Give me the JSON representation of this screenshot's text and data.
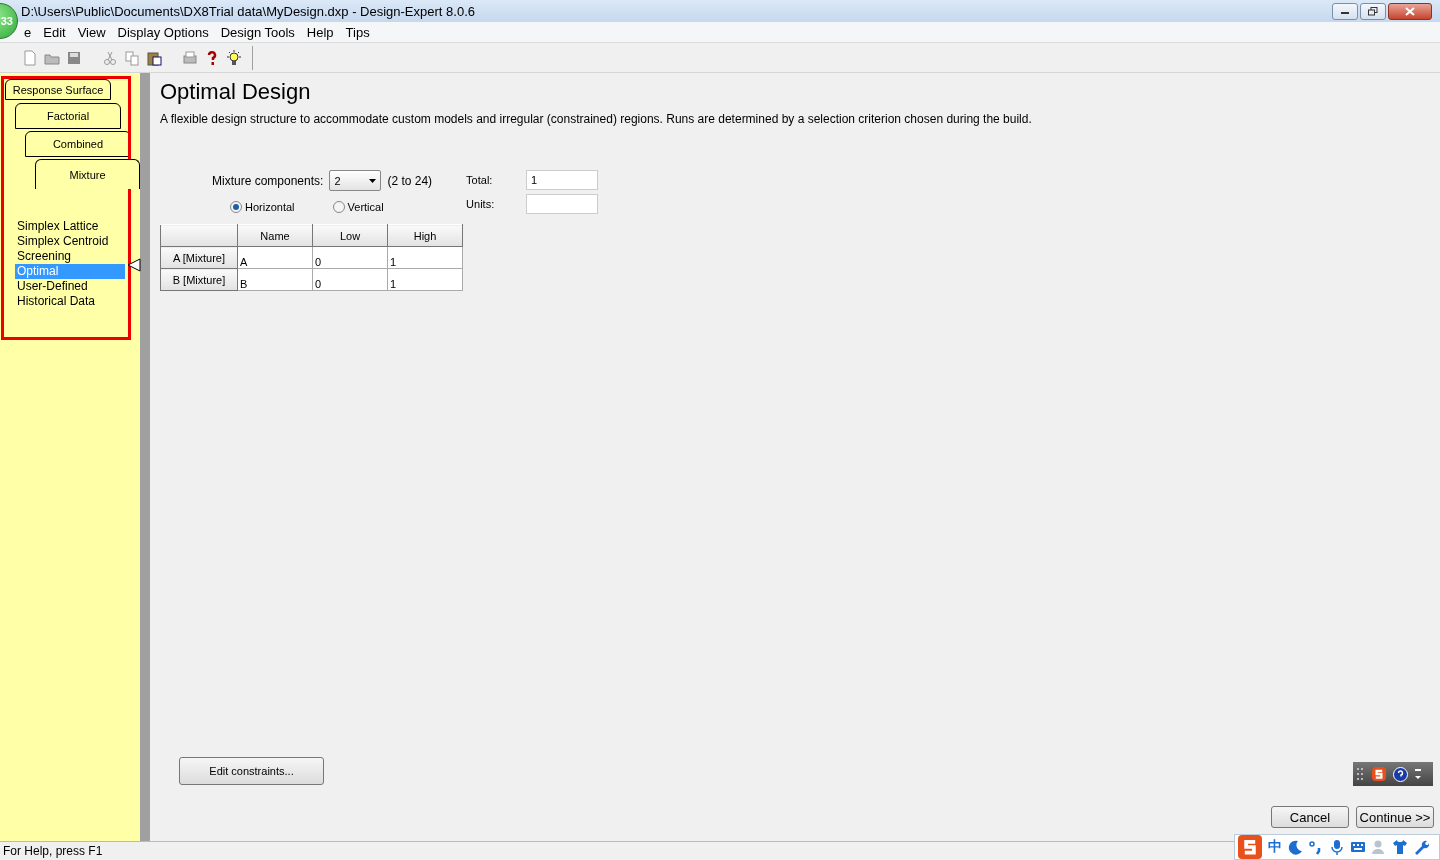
{
  "window": {
    "title": "D:\\Users\\Public\\Documents\\DX8Trial data\\MyDesign.dxp - Design-Expert 8.0.6",
    "badge": "33"
  },
  "menu": [
    "e",
    "Edit",
    "View",
    "Display Options",
    "Design Tools",
    "Help",
    "Tips"
  ],
  "design_tabs": [
    {
      "label": "Response Surface",
      "selected": false
    },
    {
      "label": "Factorial",
      "selected": false
    },
    {
      "label": "Combined",
      "selected": false
    },
    {
      "label": "Mixture",
      "selected": true
    }
  ],
  "design_types": [
    {
      "label": "Simplex Lattice",
      "selected": false
    },
    {
      "label": "Simplex Centroid",
      "selected": false
    },
    {
      "label": "Screening",
      "selected": false
    },
    {
      "label": "Optimal",
      "selected": true
    },
    {
      "label": "User-Defined",
      "selected": false
    },
    {
      "label": "Historical Data",
      "selected": false
    }
  ],
  "page": {
    "title": "Optimal Design",
    "description": "A flexible design structure to accommodate custom models and irregular (constrained) regions.  Runs are determined by a selection criterion chosen during the build."
  },
  "mixture_components": {
    "label": "Mixture components:",
    "value": "2",
    "range": "(2 to 24)"
  },
  "orientation": [
    {
      "label": "Horizontal",
      "selected": true
    },
    {
      "label": "Vertical",
      "selected": false
    }
  ],
  "total": {
    "label": "Total:",
    "value": "1"
  },
  "units": {
    "label": "Units:"
  },
  "table": {
    "columns": [
      "Name",
      "Low",
      "High"
    ],
    "rows": [
      {
        "header": "A [Mixture]",
        "cells": [
          "A",
          "0",
          "1"
        ]
      },
      {
        "header": "B [Mixture]",
        "cells": [
          "B",
          "0",
          "1"
        ]
      }
    ]
  },
  "buttons": {
    "edit_constraints": "Edit constraints...",
    "cancel": "Cancel",
    "continue": "Continue >>"
  },
  "status_bar": "For Help, press F1",
  "ime_bar": {
    "mode": "中"
  }
}
